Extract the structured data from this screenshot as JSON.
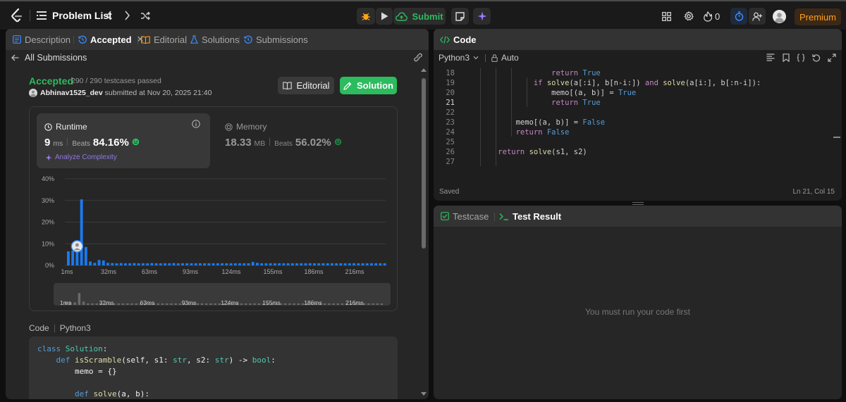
{
  "topbar": {
    "problem_list": "Problem List",
    "submit": "Submit",
    "streak_count": "0",
    "premium": "Premium",
    "colors": {
      "accent_orange": "#ffa116",
      "submit_green": "#2cbb5d",
      "premium_bg": "#3b2817"
    }
  },
  "left": {
    "tabs": {
      "description": "Description",
      "accepted": "Accepted",
      "editorial": "Editorial",
      "solutions": "Solutions",
      "submissions": "Submissions"
    },
    "back_label": "All Submissions",
    "status": "Accepted",
    "testcases": "290 / 290 testcases passed",
    "username": "Abhinav1525_dev",
    "submitted_at": "submitted at Nov 20, 2025 21:40",
    "editorial_button": "Editorial",
    "solution_button": "Solution",
    "runtime": {
      "label": "Runtime",
      "value": "9",
      "unit": "ms",
      "beats_label": "Beats",
      "beats": "84.16%",
      "analyze": "Analyze Complexity"
    },
    "memory": {
      "label": "Memory",
      "value": "18.33",
      "unit": "MB",
      "beats_label": "Beats",
      "beats": "56.02%"
    },
    "code_label": "Code",
    "code_lang": "Python3",
    "code_lines": [
      "class Solution:",
      "    def isScramble(self, s1: str, s2: str) -> bool:",
      "        memo = {}",
      "",
      "        def solve(a, b):"
    ]
  },
  "chart_data": {
    "type": "bar",
    "y_ticks": [
      "40%",
      "30%",
      "20%",
      "10%",
      "0%"
    ],
    "x_ticks": [
      "1ms",
      "32ms",
      "63ms",
      "93ms",
      "124ms",
      "155ms",
      "186ms",
      "216ms"
    ],
    "ylim": [
      0,
      40
    ],
    "values": [
      6.5,
      6.8,
      6.2,
      30.5,
      8.5,
      1.8,
      1.2,
      2.5,
      2.3,
      1.2,
      1.1,
      1.0,
      1.1,
      1.0,
      1.0,
      1.1,
      1.0,
      1.0,
      1.0,
      1.1,
      1.0,
      1.0,
      1.0,
      1.0,
      1.1,
      1.0,
      1.0,
      1.0,
      1.0,
      1.0,
      1.0,
      1.0,
      1.0,
      1.0,
      1.0,
      1.0,
      1.0,
      1.0,
      1.0,
      1.0,
      1.0,
      1.0,
      1.6,
      1.2,
      1.0,
      1.0,
      1.0,
      1.0,
      1.0,
      1.0,
      1.0,
      1.0,
      1.0,
      1.0,
      1.0,
      1.0,
      1.0,
      1.0,
      1.0,
      1.0,
      1.0,
      1.0,
      1.0,
      1.0,
      1.0,
      1.0,
      1.0,
      1.0,
      1.0,
      1.0,
      1.0,
      1.0,
      1.0
    ],
    "highlight_index": 2,
    "grid": true,
    "colors": {
      "bar": "#1a7af0",
      "grid": "#3a3a3a"
    }
  },
  "code_panel": {
    "title": "Code",
    "language": "Python3",
    "mode": "Auto",
    "saved": "Saved",
    "cursor": "Ln 21, Col 15",
    "lines": [
      {
        "n": "18",
        "text": "                return True"
      },
      {
        "n": "19",
        "text": "            if solve(a[:i], b[n-i:]) and solve(a[i:], b[:n-i]):"
      },
      {
        "n": "20",
        "text": "                memo[(a, b)] = True"
      },
      {
        "n": "21",
        "text": "                return True"
      },
      {
        "n": "22",
        "text": ""
      },
      {
        "n": "23",
        "text": "        memo[(a, b)] = False"
      },
      {
        "n": "24",
        "text": "        return False"
      },
      {
        "n": "25",
        "text": ""
      },
      {
        "n": "26",
        "text": "    return solve(s1, s2)"
      },
      {
        "n": "27",
        "text": ""
      }
    ]
  },
  "result_panel": {
    "testcase_tab": "Testcase",
    "result_tab": "Test Result",
    "empty_message": "You must run your code first"
  }
}
